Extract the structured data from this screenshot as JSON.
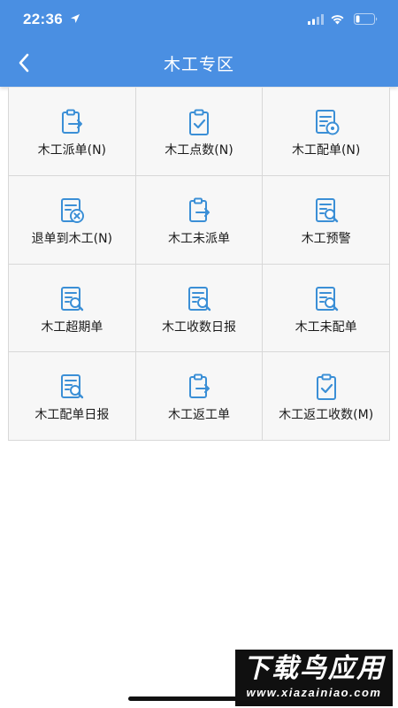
{
  "status_bar": {
    "time": "22:36",
    "icons": [
      "location-arrow-icon",
      "signal-icon",
      "wifi-icon",
      "battery-icon"
    ]
  },
  "header": {
    "title": "木工专区",
    "back_icon": "chevron-left-icon",
    "background_color": "#4a8fe2"
  },
  "menu": {
    "icon_color": "#3b8fd6",
    "items": [
      {
        "label": "木工派单(N)",
        "icon": "clipboard-arrow-icon"
      },
      {
        "label": "木工点数(N)",
        "icon": "clipboard-check-icon"
      },
      {
        "label": "木工配单(N)",
        "icon": "document-gear-icon"
      },
      {
        "label": "退单到木工(N)",
        "icon": "document-cancel-icon"
      },
      {
        "label": "木工未派单",
        "icon": "clipboard-arrow-icon"
      },
      {
        "label": "木工预警",
        "icon": "document-search-icon"
      },
      {
        "label": "木工超期单",
        "icon": "document-search-icon"
      },
      {
        "label": "木工收数日报",
        "icon": "document-search-icon"
      },
      {
        "label": "木工未配单",
        "icon": "document-search-icon"
      },
      {
        "label": "木工配单日报",
        "icon": "document-search-icon"
      },
      {
        "label": "木工返工单",
        "icon": "clipboard-arrow-icon"
      },
      {
        "label": "木工返工收数(M)",
        "icon": "clipboard-check-icon"
      }
    ]
  },
  "watermark": {
    "title": "下载鸟应用",
    "url": "www.xiazainiao.com"
  }
}
